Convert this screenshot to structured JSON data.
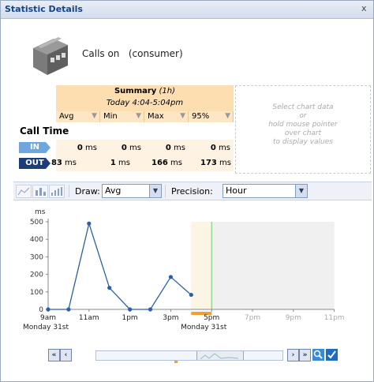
{
  "window": {
    "title": "Statistic Details",
    "close_label": "x"
  },
  "header": {
    "calls_on": "Calls on",
    "context": "(consumer)"
  },
  "summary": {
    "title": "Summary",
    "period": "(1h)",
    "time_range": "Today 4:04-5:04pm",
    "columns": [
      "Avg",
      "Min",
      "Max",
      "95%"
    ],
    "row_title": "Call Time",
    "rows": [
      {
        "label": "IN",
        "values": [
          "0",
          "0",
          "0",
          "0"
        ],
        "unit": "ms"
      },
      {
        "label": "OUT",
        "values": [
          "83",
          "1",
          "166",
          "173"
        ],
        "unit": "ms"
      }
    ]
  },
  "hint": {
    "lines": [
      "Select chart data",
      "or",
      "hold mouse pointer",
      "over chart",
      "to display values"
    ]
  },
  "toolbar": {
    "draw_label": "Draw:",
    "draw_value": "Avg",
    "precision_label": "Precision:",
    "precision_value": "Hour"
  },
  "chart_data": {
    "type": "line",
    "ylabel": "ms",
    "ylim": [
      0,
      500
    ],
    "yticks": [
      0,
      100,
      200,
      300,
      400,
      500
    ],
    "xticks": [
      "9am",
      "11am",
      "1pm",
      "3pm",
      "5pm",
      "7pm",
      "9pm",
      "11pm"
    ],
    "xday_labels": [
      "Monday 31st",
      "Monday 31st"
    ],
    "series": [
      {
        "x": [
          "9am",
          "10am",
          "11am",
          "12pm",
          "1pm",
          "2pm",
          "3pm",
          "4pm"
        ],
        "values": [
          0,
          0,
          490,
          123,
          0,
          0,
          185,
          83
        ]
      }
    ],
    "highlight_range": [
      "4pm",
      "5pm"
    ],
    "future_from": "5pm",
    "colors": {
      "line": "#2d5fa6",
      "highlight": "#fdf5e4",
      "future": "#f0f0f0",
      "now": "#66cc66",
      "marker": "#f0a030"
    }
  },
  "nav": {
    "first": "«",
    "prev": "‹",
    "next": "›",
    "last": "»"
  }
}
